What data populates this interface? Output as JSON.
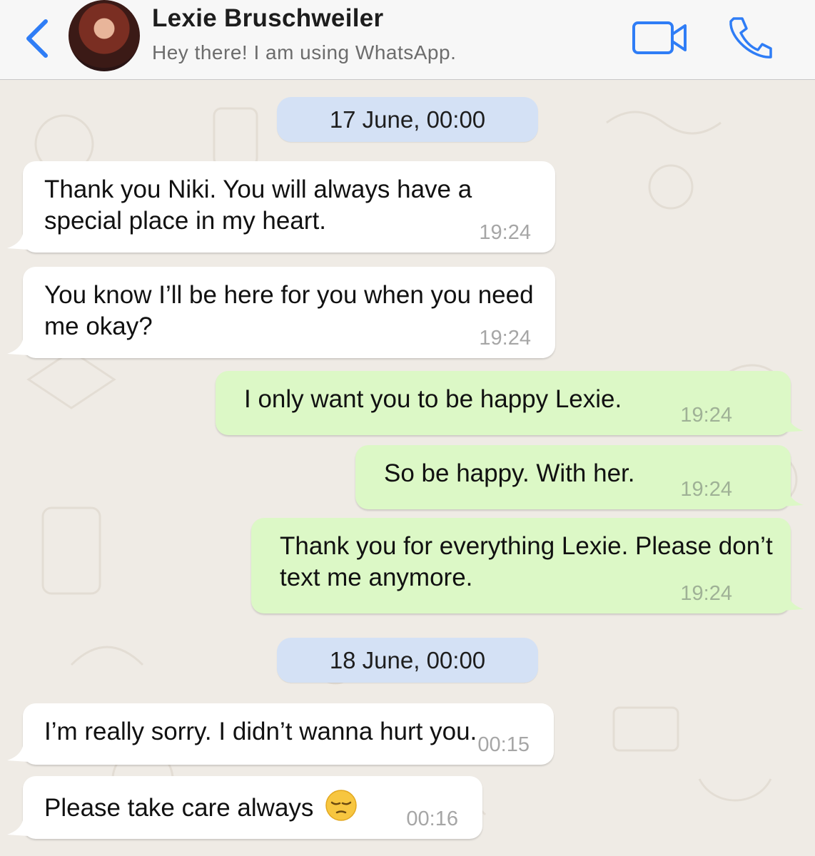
{
  "header": {
    "contact_name": "Lexie Bruschweiler",
    "contact_status": "Hey there! I am using WhatsApp.",
    "icons": [
      "chevron-left-icon",
      "video-call-icon",
      "phone-call-icon"
    ],
    "accent_color": "#2f7df6"
  },
  "dates": [
    "17 June, 00:00",
    "18 June, 00:00"
  ],
  "messages": [
    {
      "direction": "in",
      "text": "Thank you Niki. You will always have a special place in my heart.",
      "time": "19:24"
    },
    {
      "direction": "in",
      "text": "You know I’ll be here for you when you need me okay?",
      "time": "19:24"
    },
    {
      "direction": "out",
      "text": "I only want you to be happy Lexie.",
      "time": "19:24"
    },
    {
      "direction": "out",
      "text": "So be happy. With her.",
      "time": "19:24"
    },
    {
      "direction": "out",
      "text": "Thank you for everything Lexie. Please don’t text me anymore.",
      "time": "19:24"
    },
    {
      "direction": "in",
      "text": "I’m really sorry. I didn’t wanna hurt you.",
      "time": "00:15"
    },
    {
      "direction": "in",
      "text": "Please take care always",
      "emoji": "pensive-face",
      "time": "00:16"
    }
  ],
  "colors": {
    "incoming_bubble": "#ffffff",
    "outgoing_bubble": "#dcf8c6",
    "date_pill": "#d4e1f5",
    "chat_background": "#efebe5"
  }
}
